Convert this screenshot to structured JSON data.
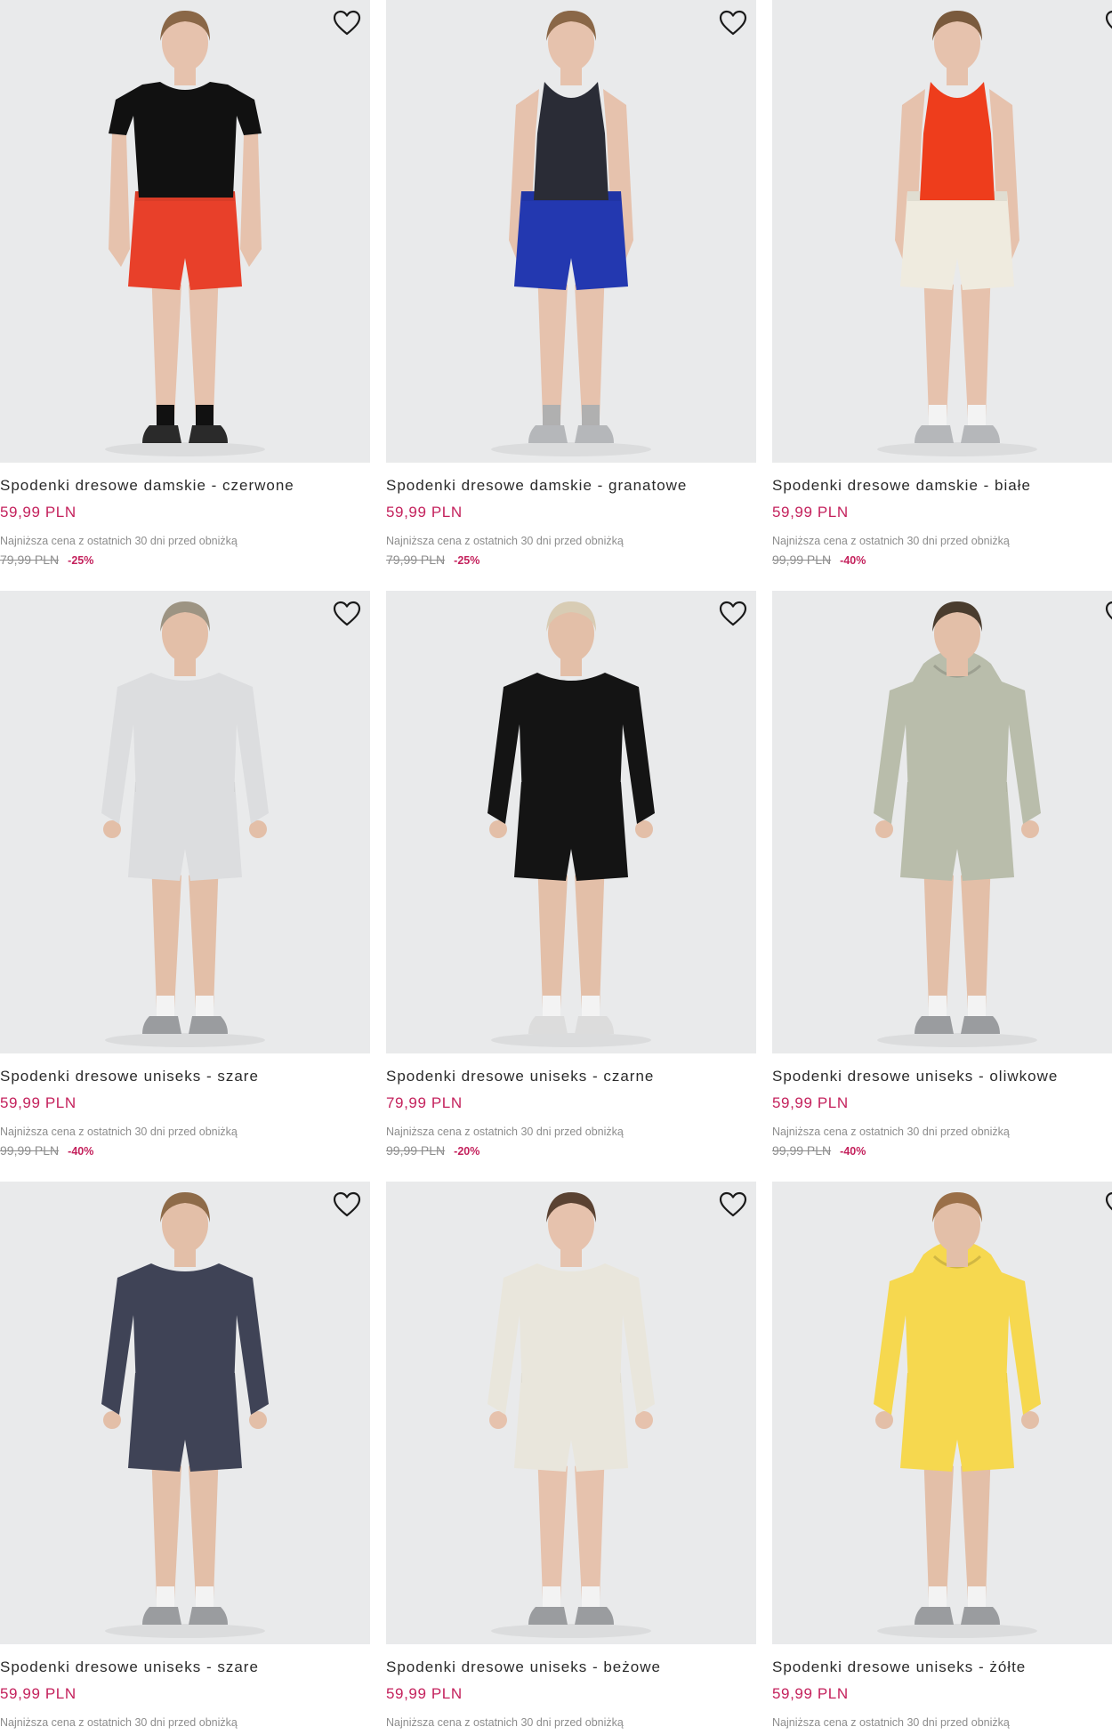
{
  "products": [
    {
      "title": "Spodenki dresowe damskie - czerwone",
      "price": "59,99 PLN",
      "lowest_label": "Najniższa cena z ostatnich 30 dni przed obniżką",
      "old_price": "79,99 PLN",
      "discount": "-25%",
      "colors": {
        "top": "#111111",
        "shorts": "#e8402a",
        "skin": "#e6c2ad",
        "hair": "#8a6747",
        "shoes": "#2a2a2a",
        "socks": "#111111"
      },
      "top_type": "tee"
    },
    {
      "title": "Spodenki dresowe damskie - granatowe",
      "price": "59,99 PLN",
      "lowest_label": "Najniższa cena z ostatnich 30 dni przed obniżką",
      "old_price": "79,99 PLN",
      "discount": "-25%",
      "colors": {
        "top": "#2a2c36",
        "shorts": "#2338b0",
        "skin": "#e6c2ad",
        "hair": "#8a6747",
        "shoes": "#b5b7ba",
        "socks": "#b0b0b0"
      },
      "top_type": "tank"
    },
    {
      "title": "Spodenki dresowe damskie - białe",
      "price": "59,99 PLN",
      "lowest_label": "Najniższa cena z ostatnich 30 dni przed obniżką",
      "old_price": "99,99 PLN",
      "discount": "-40%",
      "colors": {
        "top": "#ee3d1c",
        "shorts": "#efebdf",
        "skin": "#e6c2ad",
        "hair": "#7a5a3d",
        "shoes": "#b5b7ba",
        "socks": "#f3f3f3"
      },
      "top_type": "tank"
    },
    {
      "title": "Spodenki dresowe uniseks - szare",
      "price": "59,99 PLN",
      "lowest_label": "Najniższa cena z ostatnich 30 dni przed obniżką",
      "old_price": "99,99 PLN",
      "discount": "-40%",
      "colors": {
        "top": "#dcdddf",
        "shorts": "#dcdddf",
        "skin": "#e3bfa8",
        "hair": "#9d9483",
        "shoes": "#9a9c9f",
        "socks": "#f3f3f3"
      },
      "top_type": "sweat"
    },
    {
      "title": "Spodenki dresowe uniseks - czarne",
      "price": "79,99 PLN",
      "lowest_label": "Najniższa cena z ostatnich 30 dni przed obniżką",
      "old_price": "99,99 PLN",
      "discount": "-20%",
      "colors": {
        "top": "#141414",
        "shorts": "#141414",
        "skin": "#e3bfa8",
        "hair": "#d8ccb4",
        "shoes": "#dcdcdc",
        "socks": "#f3f3f3"
      },
      "top_type": "sweat"
    },
    {
      "title": "Spodenki dresowe uniseks - oliwkowe",
      "price": "59,99 PLN",
      "lowest_label": "Najniższa cena z ostatnich 30 dni przed obniżką",
      "old_price": "99,99 PLN",
      "discount": "-40%",
      "colors": {
        "top": "#b9bdab",
        "shorts": "#b9bdab",
        "skin": "#e3bfa8",
        "hair": "#4a3c2e",
        "shoes": "#9a9c9f",
        "socks": "#f3f3f3"
      },
      "top_type": "hoodie"
    },
    {
      "title": "Spodenki dresowe uniseks - szare",
      "price": "59,99 PLN",
      "lowest_label": "Najniższa cena z ostatnich 30 dni przed obniżką",
      "colors": {
        "top": "#3f4356",
        "shorts": "#3f4356",
        "skin": "#e3bfa8",
        "hair": "#8e6b49",
        "shoes": "#9a9c9f",
        "socks": "#f3f3f3"
      },
      "top_type": "sweat"
    },
    {
      "title": "Spodenki dresowe uniseks - beżowe",
      "price": "59,99 PLN",
      "lowest_label": "Najniższa cena z ostatnich 30 dni przed obniżką",
      "colors": {
        "top": "#e9e6dc",
        "shorts": "#e9e6dc",
        "skin": "#e6c2ad",
        "hair": "#5a4232",
        "shoes": "#9a9c9f",
        "socks": "#f3f3f3"
      },
      "top_type": "sweat"
    },
    {
      "title": "Spodenki dresowe uniseks - żółte",
      "price": "59,99 PLN",
      "lowest_label": "Najniższa cena z ostatnich 30 dni przed obniżką",
      "colors": {
        "top": "#f6d84f",
        "shorts": "#f6d84f",
        "skin": "#e3bfa8",
        "hair": "#9a6f48",
        "shoes": "#9a9c9f",
        "socks": "#f3f3f3"
      },
      "top_type": "hoodie"
    }
  ],
  "accent_color": "#c4215c",
  "icons": {
    "favorite": "heart-outline-icon"
  }
}
